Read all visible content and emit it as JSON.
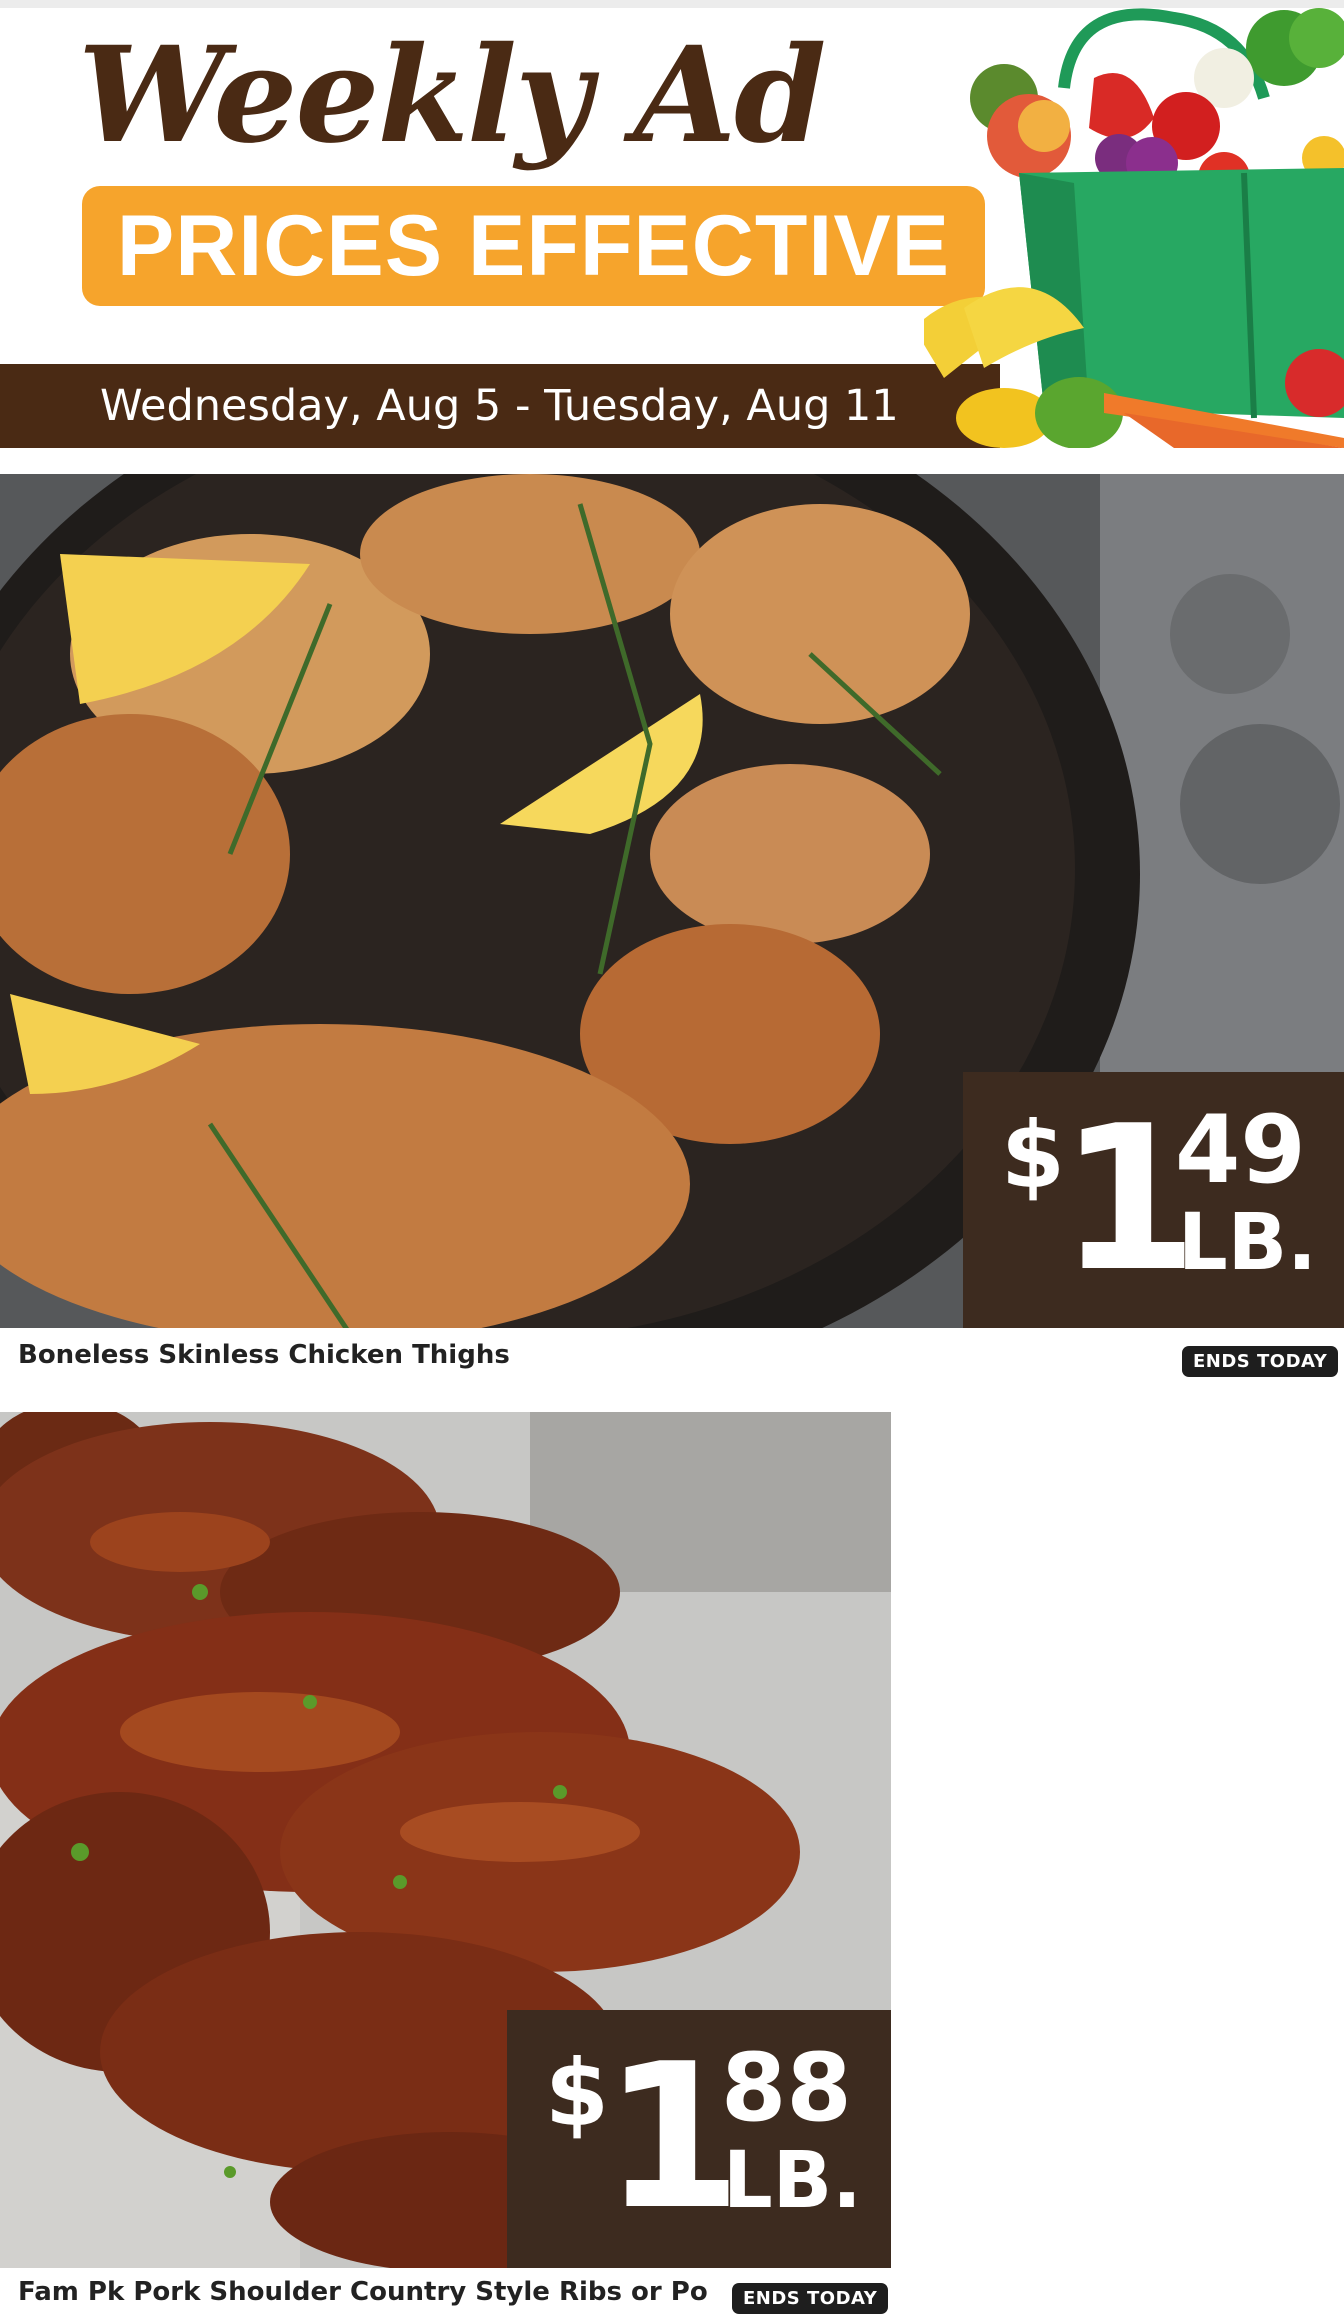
{
  "banner": {
    "title": "Weekly Ad",
    "subtitle": "PRICES EFFECTIVE",
    "dates": "Wednesday, Aug 5 - Tuesday, Aug 11"
  },
  "colors": {
    "brand_brown": "#4a2a14",
    "accent_orange": "#f6a42c",
    "price_box": "#3d2b1f"
  },
  "products": [
    {
      "name": "Boneless Skinless Chicken Thighs",
      "price_symbol": "$",
      "price_whole": "1",
      "price_cents": "49",
      "price_unit": "LB.",
      "badge": "ENDS TODAY"
    },
    {
      "name": "Fam Pk Pork Shoulder Country Style Ribs or Pork ...",
      "price_symbol": "$",
      "price_whole": "1",
      "price_cents": "88",
      "price_unit": "LB.",
      "badge": "ENDS TODAY"
    }
  ]
}
